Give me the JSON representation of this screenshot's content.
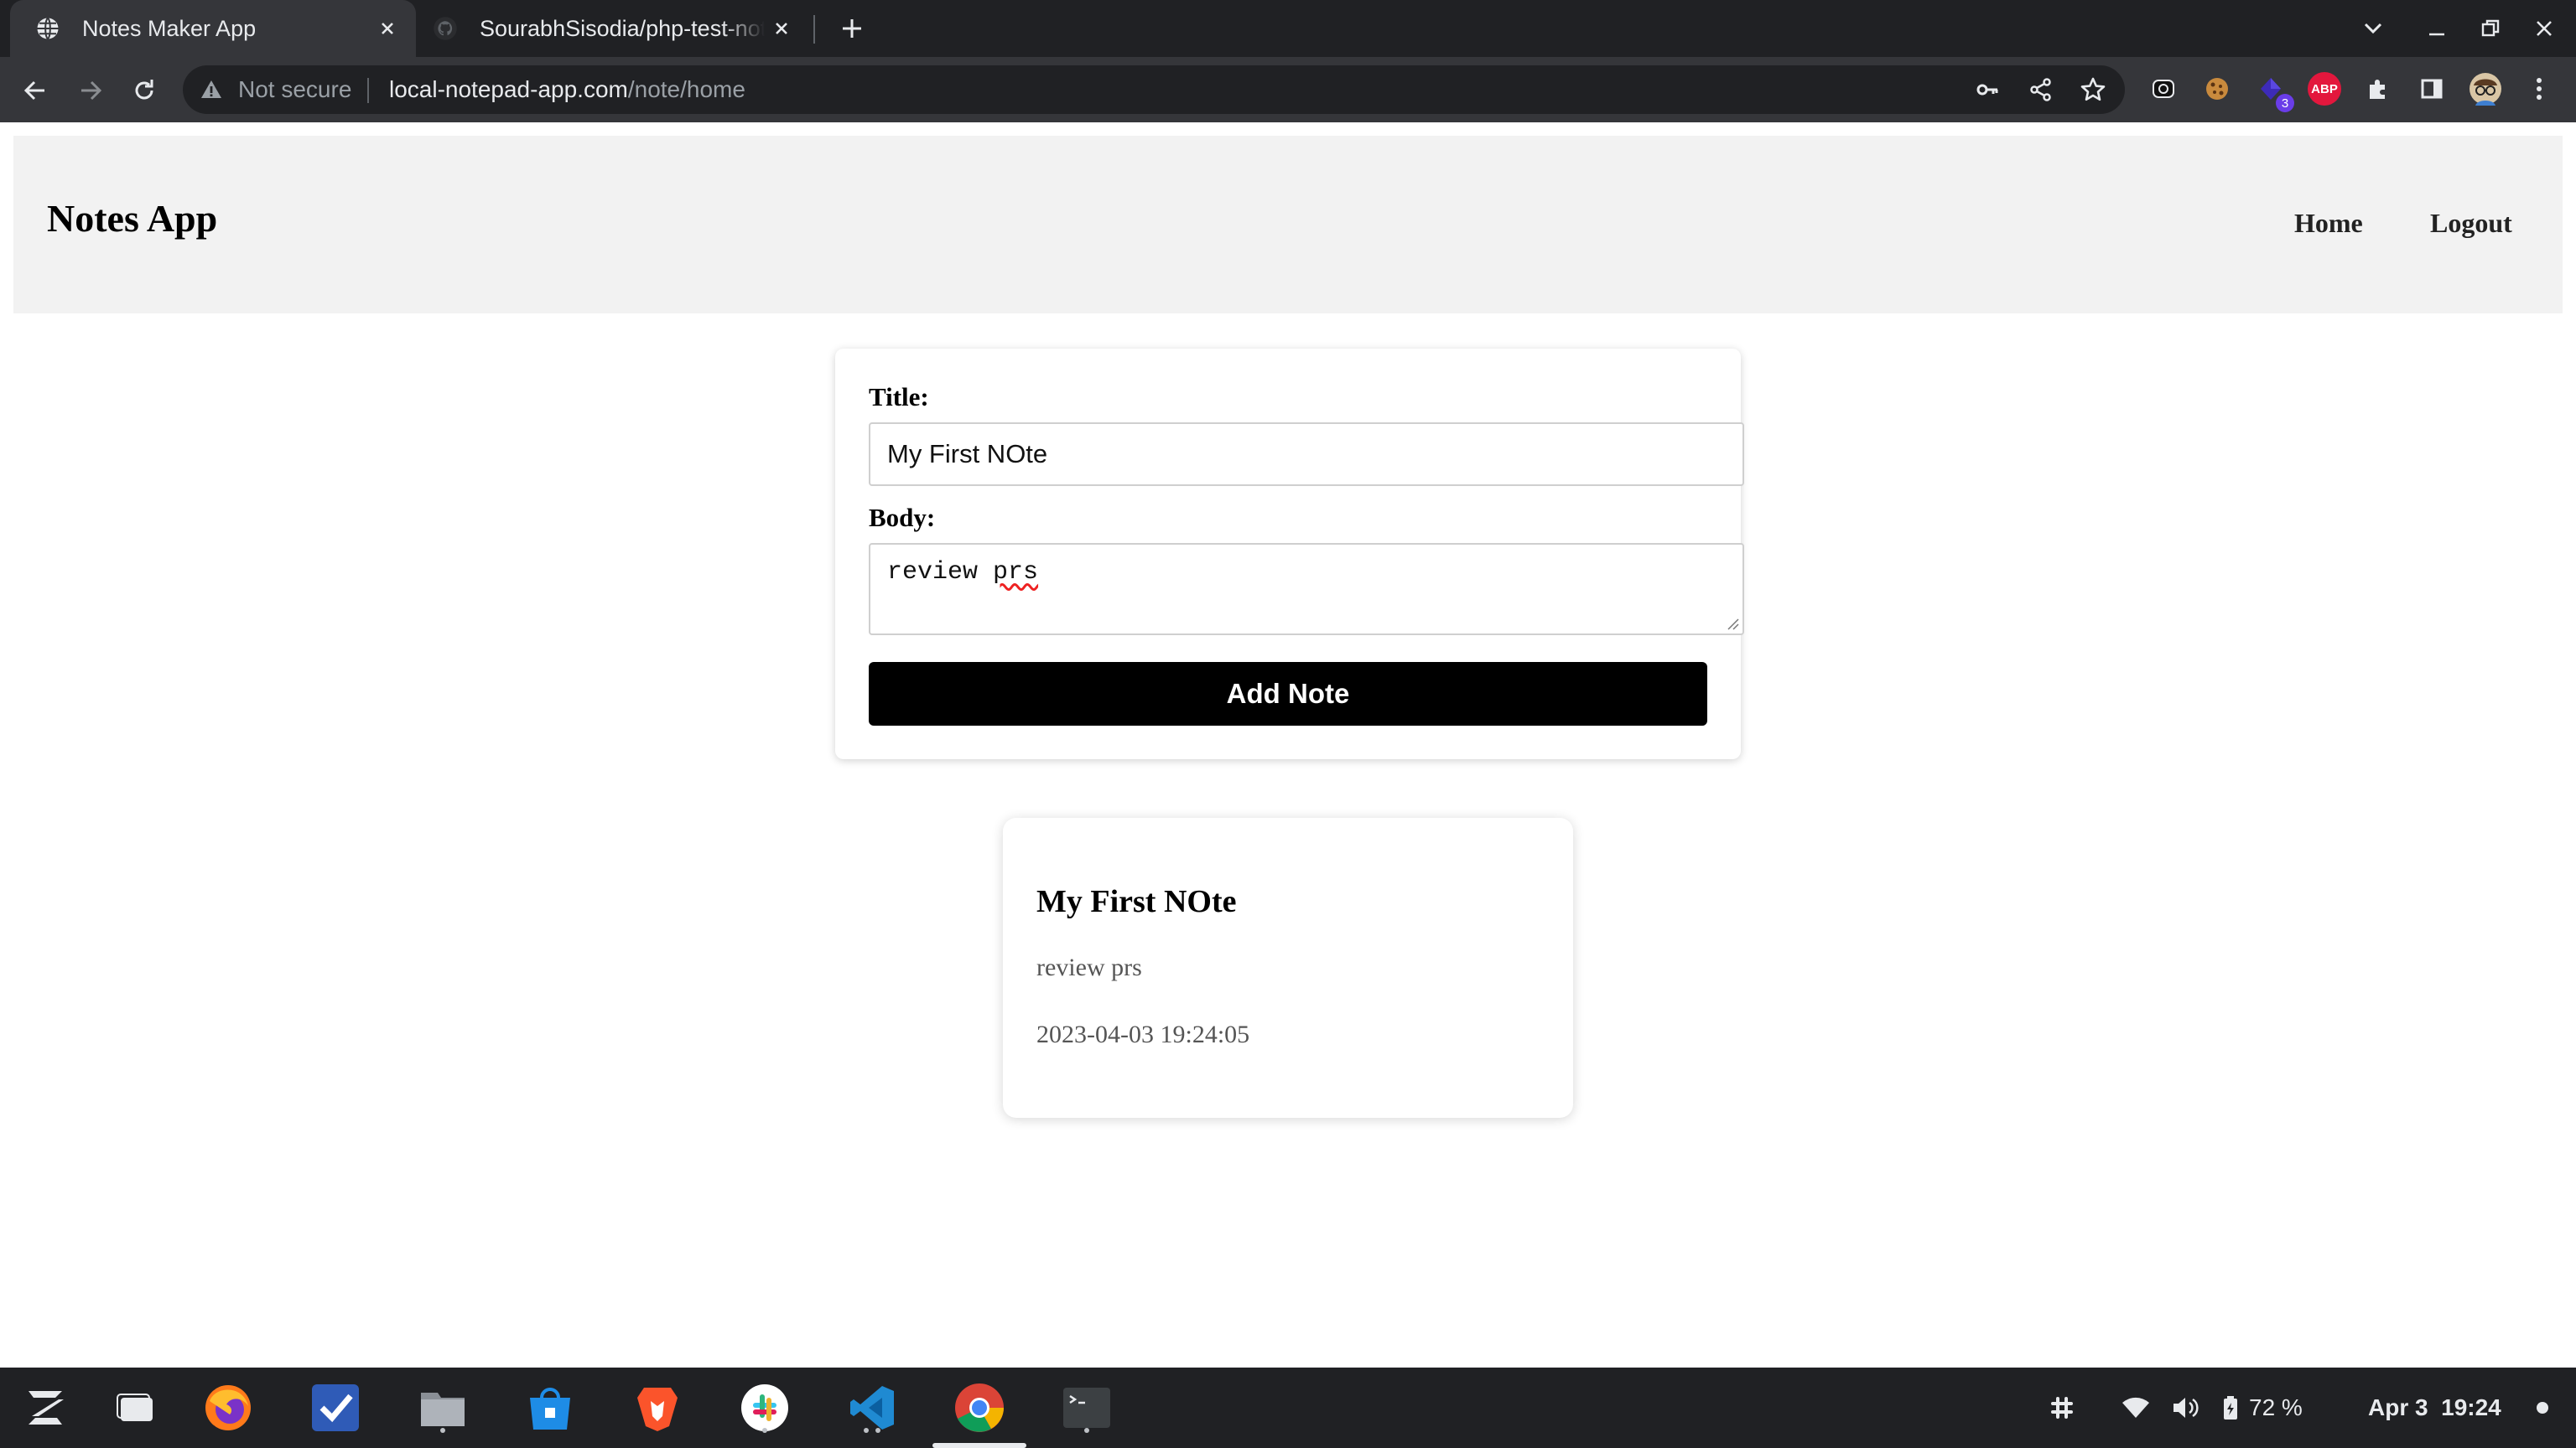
{
  "browser": {
    "tabs": [
      {
        "title": "Notes Maker App",
        "active": true
      },
      {
        "title": "SourabhSisodia/php-test-notes",
        "active": false
      }
    ],
    "address": {
      "security_label": "Not secure",
      "host": "local-notepad-app.com",
      "path": "/note/home"
    },
    "extensions": {
      "badge_count": "3",
      "abp_label": "ABP"
    }
  },
  "navbar": {
    "brand": "Notes App",
    "links": [
      "Home",
      "Logout"
    ]
  },
  "form": {
    "title_label": "Title:",
    "title_value": "My First NOte",
    "body_label": "Body:",
    "body_value_first": "review",
    "body_value_second": "prs",
    "submit_label": "Add Note"
  },
  "notes": [
    {
      "title": "My First NOte",
      "body": "review prs",
      "timestamp": "2023-04-03 19:24:05"
    }
  ],
  "shelf": {
    "battery": "72 %",
    "date": "Apr 3",
    "time": "19:24"
  },
  "colors": {
    "tabstrip": "#202124",
    "toolbar": "#35363a",
    "navbar_bg": "#f2f2f2",
    "button_bg": "#000000",
    "spellcheck": "#ee2222"
  }
}
